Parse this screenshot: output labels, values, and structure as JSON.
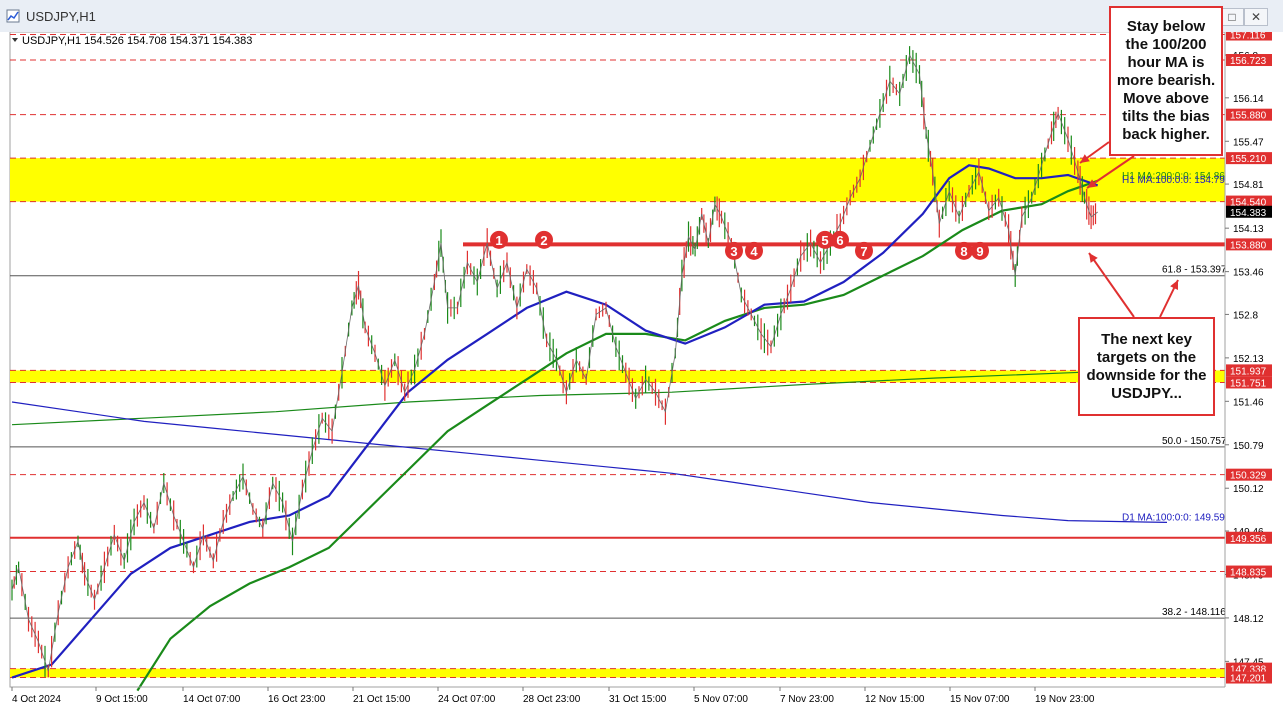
{
  "window": {
    "title": "USDJPY,H1",
    "buttons": [
      "minimize",
      "maximize",
      "close"
    ]
  },
  "info_line": "USDJPY,H1  154.526 154.708 154.371 154.383",
  "callouts": {
    "top": "Stay below the 100/200 hour MA is more bearish. Move above tilts the bias back higher.",
    "bottom": "The next key targets on the downside for the USDJPY..."
  },
  "chart_data": {
    "type": "line",
    "symbol": "USDJPY",
    "timeframe": "H1",
    "ylim": [
      147.0,
      157.3
    ],
    "grid": false,
    "x_tick_labels": [
      "4 Oct 2024",
      "9 Oct 15:00",
      "14 Oct 07:00",
      "16 Oct 23:00",
      "21 Oct 15:00",
      "24 Oct 07:00",
      "28 Oct 23:00",
      "31 Oct 15:00",
      "5 Nov 07:00",
      "7 Nov 23:00",
      "12 Nov 15:00",
      "15 Nov 07:00",
      "19 Nov 23:00"
    ],
    "y_tick_labels": [
      156.8,
      156.14,
      155.47,
      154.81,
      154.13,
      153.46,
      152.8,
      152.13,
      151.46,
      150.79,
      150.12,
      149.46,
      148.79,
      148.12,
      147.45
    ],
    "price_labels": [
      {
        "value": "157.116",
        "bg": "#e03030"
      },
      {
        "value": "156.723",
        "bg": "#e03030"
      },
      {
        "value": "155.880",
        "bg": "#e03030"
      },
      {
        "value": "155.210",
        "bg": "#e03030"
      },
      {
        "value": "154.540",
        "bg": "#e03030"
      },
      {
        "value": "154.383",
        "bg": "#000000"
      },
      {
        "value": "153.880",
        "bg": "#e03030"
      },
      {
        "value": "151.937",
        "bg": "#e03030"
      },
      {
        "value": "151.751",
        "bg": "#e03030"
      },
      {
        "value": "150.329",
        "bg": "#e03030"
      },
      {
        "value": "149.356",
        "bg": "#e03030"
      },
      {
        "value": "148.835",
        "bg": "#e03030"
      },
      {
        "value": "147.338",
        "bg": "#e03030"
      },
      {
        "value": "147.201",
        "bg": "#e03030"
      }
    ],
    "zones": [
      {
        "from": 154.54,
        "to": 155.21,
        "color": "#ffff00"
      },
      {
        "from": 151.751,
        "to": 151.937,
        "color": "#ffff00"
      },
      {
        "from": 147.201,
        "to": 147.338,
        "color": "#ffff00"
      }
    ],
    "dashed_levels": [
      157.116,
      156.723,
      155.88,
      150.329,
      148.835
    ],
    "solid_levels": [
      {
        "value": 149.356,
        "width": 2
      },
      {
        "value": 153.88,
        "width": 4
      }
    ],
    "fib_levels": [
      {
        "label": "61.8 - 153.397",
        "value": 153.397
      },
      {
        "label": "50.0 - 150.757",
        "value": 150.757
      },
      {
        "label": "38.2 - 148.116",
        "value": 148.116
      }
    ],
    "ma_labels": [
      {
        "label": "H1 MA:200:0:0: 154.860",
        "value": 154.86,
        "color": "#1a8a1a"
      },
      {
        "label": "H1 MA:100:0:0: 154.793",
        "value": 154.793,
        "color": "#2020c0"
      },
      {
        "label": "D1 MA:100:0:0: 149.593",
        "value": 149.593,
        "color": "#2020c0"
      }
    ],
    "swing_markers": [
      {
        "label": "1",
        "value": 153.95
      },
      {
        "label": "2",
        "value": 153.95
      },
      {
        "label": "3",
        "value": 153.78
      },
      {
        "label": "4",
        "value": 153.78
      },
      {
        "label": "5",
        "value": 153.95
      },
      {
        "label": "6",
        "value": 153.95
      },
      {
        "label": "7",
        "value": 153.78
      },
      {
        "label": "8",
        "value": 153.78
      },
      {
        "label": "9",
        "value": 153.78
      }
    ],
    "price_series": [
      [
        0,
        148.55
      ],
      [
        2,
        148.9
      ],
      [
        5,
        148.1
      ],
      [
        8,
        147.75
      ],
      [
        11,
        147.3
      ],
      [
        14,
        148.2
      ],
      [
        17,
        148.9
      ],
      [
        20,
        149.3
      ],
      [
        22,
        148.8
      ],
      [
        25,
        148.4
      ],
      [
        28,
        148.9
      ],
      [
        31,
        149.4
      ],
      [
        34,
        149.0
      ],
      [
        37,
        149.6
      ],
      [
        40,
        149.9
      ],
      [
        43,
        149.5
      ],
      [
        46,
        150.2
      ],
      [
        49,
        149.7
      ],
      [
        52,
        149.3
      ],
      [
        55,
        148.9
      ],
      [
        58,
        149.4
      ],
      [
        61,
        149.0
      ],
      [
        64,
        149.6
      ],
      [
        67,
        150.0
      ],
      [
        70,
        150.3
      ],
      [
        73,
        149.8
      ],
      [
        76,
        149.5
      ],
      [
        79,
        150.2
      ],
      [
        82,
        149.9
      ],
      [
        85,
        149.3
      ],
      [
        88,
        150.1
      ],
      [
        91,
        150.7
      ],
      [
        94,
        151.2
      ],
      [
        97,
        151.0
      ],
      [
        100,
        151.9
      ],
      [
        103,
        152.9
      ],
      [
        105,
        153.25
      ],
      [
        107,
        152.6
      ],
      [
        110,
        152.2
      ],
      [
        113,
        151.7
      ],
      [
        116,
        152.1
      ],
      [
        119,
        151.6
      ],
      [
        122,
        151.95
      ],
      [
        125,
        152.5
      ],
      [
        128,
        153.3
      ],
      [
        130,
        153.9
      ],
      [
        132,
        152.9
      ],
      [
        135,
        152.9
      ],
      [
        138,
        153.6
      ],
      [
        141,
        153.3
      ],
      [
        144,
        153.9
      ],
      [
        147,
        153.2
      ],
      [
        150,
        153.6
      ],
      [
        153,
        152.9
      ],
      [
        156,
        153.5
      ],
      [
        159,
        153.2
      ],
      [
        162,
        152.4
      ],
      [
        165,
        152.1
      ],
      [
        168,
        151.6
      ],
      [
        171,
        152.1
      ],
      [
        174,
        151.8
      ],
      [
        177,
        152.8
      ],
      [
        180,
        152.9
      ],
      [
        183,
        152.3
      ],
      [
        186,
        151.9
      ],
      [
        189,
        151.5
      ],
      [
        192,
        151.8
      ],
      [
        195,
        151.6
      ],
      [
        198,
        151.3
      ],
      [
        201,
        152.2
      ],
      [
        203,
        153.4
      ],
      [
        205,
        154.0
      ],
      [
        207,
        153.8
      ],
      [
        209,
        154.35
      ],
      [
        211,
        153.9
      ],
      [
        213,
        154.5
      ],
      [
        215,
        154.3
      ],
      [
        218,
        153.9
      ],
      [
        221,
        153.1
      ],
      [
        224,
        152.8
      ],
      [
        227,
        152.5
      ],
      [
        230,
        152.3
      ],
      [
        233,
        152.8
      ],
      [
        236,
        153.2
      ],
      [
        239,
        153.7
      ],
      [
        242,
        153.9
      ],
      [
        245,
        153.6
      ],
      [
        248,
        153.9
      ],
      [
        251,
        154.2
      ],
      [
        254,
        154.6
      ],
      [
        257,
        154.9
      ],
      [
        260,
        155.4
      ],
      [
        263,
        155.9
      ],
      [
        266,
        156.4
      ],
      [
        269,
        156.2
      ],
      [
        272,
        156.8
      ],
      [
        275,
        156.5
      ],
      [
        277,
        155.6
      ],
      [
        279,
        155.0
      ],
      [
        281,
        154.2
      ],
      [
        284,
        154.7
      ],
      [
        287,
        154.3
      ],
      [
        290,
        154.7
      ],
      [
        293,
        155.0
      ],
      [
        296,
        154.4
      ],
      [
        299,
        154.6
      ],
      [
        302,
        154.1
      ],
      [
        304,
        153.4
      ],
      [
        306,
        154.3
      ],
      [
        309,
        154.6
      ],
      [
        312,
        155.1
      ],
      [
        315,
        155.6
      ],
      [
        317,
        155.9
      ],
      [
        320,
        155.5
      ],
      [
        323,
        155.0
      ],
      [
        325,
        154.6
      ],
      [
        327,
        154.3
      ],
      [
        329,
        154.38
      ]
    ],
    "ma_h1_100": [
      [
        0,
        147.2
      ],
      [
        12,
        147.4
      ],
      [
        24,
        148.1
      ],
      [
        36,
        148.8
      ],
      [
        48,
        149.2
      ],
      [
        60,
        149.4
      ],
      [
        72,
        149.6
      ],
      [
        84,
        149.7
      ],
      [
        96,
        150.0
      ],
      [
        108,
        150.8
      ],
      [
        120,
        151.6
      ],
      [
        132,
        152.1
      ],
      [
        144,
        152.5
      ],
      [
        156,
        152.9
      ],
      [
        168,
        153.15
      ],
      [
        180,
        152.95
      ],
      [
        192,
        152.55
      ],
      [
        204,
        152.35
      ],
      [
        216,
        152.6
      ],
      [
        228,
        152.95
      ],
      [
        240,
        153.0
      ],
      [
        252,
        153.3
      ],
      [
        264,
        153.75
      ],
      [
        276,
        154.35
      ],
      [
        284,
        154.9
      ],
      [
        290,
        155.1
      ],
      [
        296,
        155.05
      ],
      [
        304,
        154.9
      ],
      [
        312,
        154.9
      ],
      [
        320,
        154.95
      ],
      [
        329,
        154.79
      ]
    ],
    "ma_h1_200": [
      [
        38,
        147.0
      ],
      [
        48,
        147.8
      ],
      [
        60,
        148.3
      ],
      [
        72,
        148.65
      ],
      [
        84,
        148.9
      ],
      [
        96,
        149.2
      ],
      [
        108,
        149.8
      ],
      [
        120,
        150.4
      ],
      [
        132,
        151.0
      ],
      [
        144,
        151.4
      ],
      [
        156,
        151.8
      ],
      [
        168,
        152.2
      ],
      [
        180,
        152.5
      ],
      [
        192,
        152.5
      ],
      [
        204,
        152.4
      ],
      [
        216,
        152.7
      ],
      [
        228,
        152.9
      ],
      [
        240,
        152.95
      ],
      [
        252,
        153.1
      ],
      [
        264,
        153.4
      ],
      [
        276,
        153.7
      ],
      [
        288,
        154.1
      ],
      [
        300,
        154.4
      ],
      [
        312,
        154.5
      ],
      [
        320,
        154.7
      ],
      [
        329,
        154.86
      ]
    ],
    "ma_d1_100": [
      [
        0,
        151.45
      ],
      [
        20,
        151.3
      ],
      [
        40,
        151.15
      ],
      [
        60,
        151.05
      ],
      [
        80,
        150.95
      ],
      [
        100,
        150.85
      ],
      [
        120,
        150.75
      ],
      [
        140,
        150.65
      ],
      [
        160,
        150.55
      ],
      [
        180,
        150.45
      ],
      [
        200,
        150.35
      ],
      [
        220,
        150.2
      ],
      [
        240,
        150.05
      ],
      [
        260,
        149.9
      ],
      [
        280,
        149.8
      ],
      [
        300,
        149.7
      ],
      [
        320,
        149.62
      ],
      [
        350,
        149.593
      ]
    ],
    "ma_d1_200": [
      [
        0,
        151.1
      ],
      [
        40,
        151.2
      ],
      [
        80,
        151.3
      ],
      [
        120,
        151.45
      ],
      [
        160,
        151.55
      ],
      [
        200,
        151.6
      ],
      [
        240,
        151.72
      ],
      [
        280,
        151.82
      ],
      [
        320,
        151.9
      ],
      [
        350,
        151.96
      ]
    ]
  }
}
